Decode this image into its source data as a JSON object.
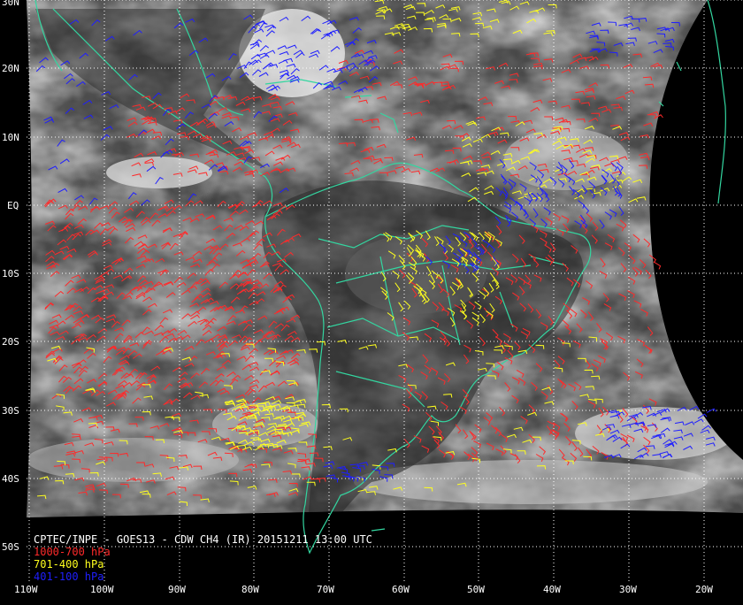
{
  "map": {
    "title": "CPTEC/INPE - GOES13 - CDW CH4 (IR) 20151211 13:00 UTC",
    "legend": [
      {
        "label": "1000-700 hPa",
        "color": "#ff2a2a"
      },
      {
        "label": "701-400 hPa",
        "color": "#ffff1e"
      },
      {
        "label": "401-100 hPa",
        "color": "#1f1fff"
      }
    ],
    "lat_labels": [
      "30N",
      "20N",
      "10N",
      "EQ",
      "10S",
      "20S",
      "30S",
      "40S",
      "50S"
    ],
    "lon_labels": [
      "110W",
      "100W",
      "90W",
      "80W",
      "70W",
      "60W",
      "50W",
      "40W",
      "30W",
      "20W"
    ],
    "colors": {
      "coast": "#33d6a0",
      "grid": "#ffffff",
      "background": "#000000"
    }
  }
}
